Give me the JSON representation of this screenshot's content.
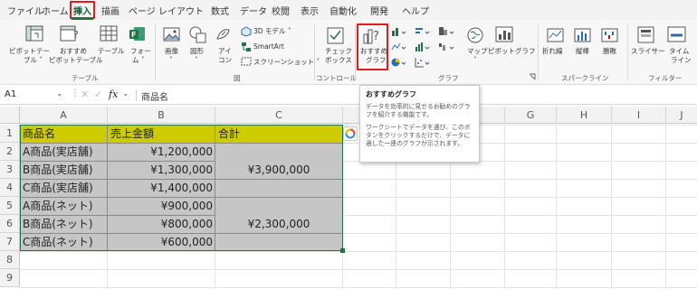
{
  "menu": {
    "items": [
      "ファイル",
      "ホーム",
      "挿入",
      "描画",
      "ページ レイアウト",
      "数式",
      "データ",
      "校閲",
      "表示",
      "自動化",
      "開発",
      "ヘルプ"
    ]
  },
  "ribbon": {
    "pivot_line1": "ピボットテー",
    "pivot_line2": "ブル ˅",
    "rec_pivot_line1": "おすすめ",
    "rec_pivot_line2": "ピボットテーブル",
    "table": "テーブル",
    "form_line1": "フォー",
    "form_line2": "ム ˅",
    "image_line1": "画像",
    "image_line2": "˅",
    "shape_line1": "図形",
    "shape_line2": "˅",
    "icon_line1": "アイ",
    "icon_line2": "コン",
    "model3d": "3D モデル ˅",
    "smartart": "SmartArt",
    "screenshot": "スクリーンショット ˅",
    "checkbox_line1": "チェック",
    "checkbox_line2": "ボックス",
    "rec_chart_line1": "おすすめ",
    "rec_chart_line2": "グラフ",
    "map_line1": "マップ",
    "map_line2": "˅",
    "pivot_chart": "ピボットグラフ",
    "line": "折れ線",
    "column": "縦棒",
    "winloss": "勝敗",
    "slicer": "スライサー",
    "timeline_line1": "タイム",
    "timeline_line2": "ライン",
    "groups": {
      "table": "テーブル",
      "illustration": "図",
      "control": "コントロール",
      "chart": "グラフ",
      "sparkline": "スパークライン",
      "filter": "フィルター"
    }
  },
  "formula_bar": {
    "name_box": "A1",
    "fx": "fx",
    "content": "商品名"
  },
  "columns": [
    "A",
    "B",
    "C",
    "D",
    "E",
    "F",
    "G",
    "H",
    "I",
    "J"
  ],
  "rows": [
    "1",
    "2",
    "3",
    "4",
    "5",
    "6",
    "7",
    "8",
    "9"
  ],
  "sheet": {
    "header": [
      "商品名",
      "売上金額",
      "合計"
    ],
    "products": [
      "A商品(実店舗)",
      "B商品(実店舗)",
      "C商品(実店舗)",
      "A商品(ネット)",
      "B商品(ネット)",
      "C商品(ネット)"
    ],
    "amounts": [
      "¥1,200,000",
      "¥1,300,000",
      "¥1,400,000",
      "¥900,000",
      "¥800,000",
      "¥600,000"
    ],
    "totals": [
      "¥3,900,000",
      "¥2,300,000"
    ]
  },
  "tooltip": {
    "title": "おすすめグラフ",
    "p1": "データを効率的に見せるお勧めのグラフを紹介する機能です。",
    "p2": "ワークシートでデータを選び、このボタンをクリックするだけで、データに適した一連のグラフが示されます。"
  },
  "colors": {
    "header_fill": "#cccc00",
    "selection_fill": "#c6c6c6",
    "highlight_red": "#e21b1b",
    "excel_green": "#217346"
  }
}
